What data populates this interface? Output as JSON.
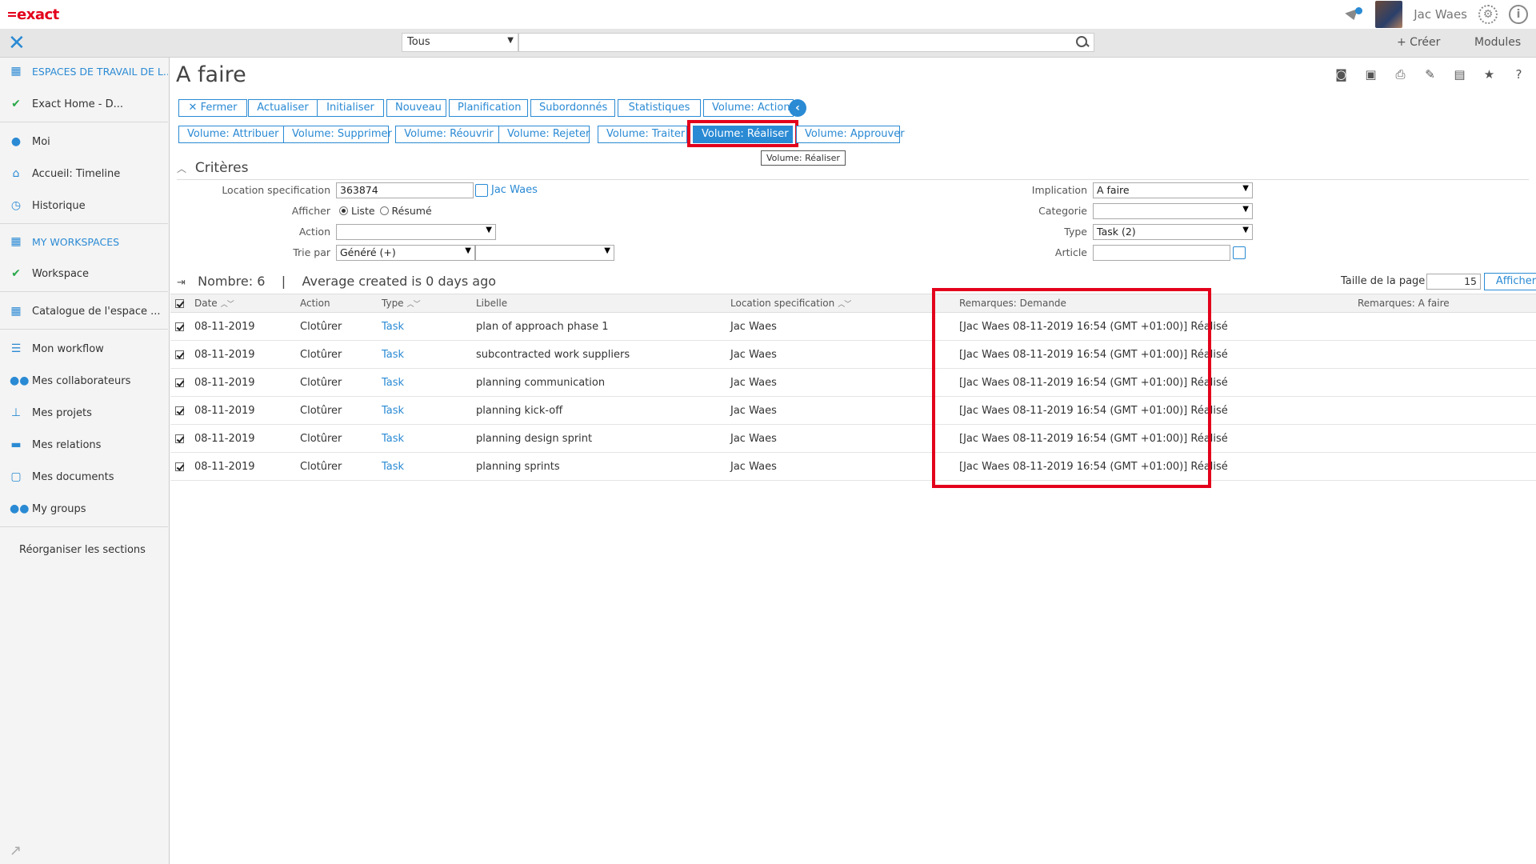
{
  "header": {
    "logo": "exact",
    "user_name": "Jac Waes",
    "info_glyph": "i"
  },
  "navbar": {
    "scope_value": "Tous",
    "search_value": "",
    "create_label": "+ Créer",
    "modules_label": "Modules"
  },
  "sidebar": {
    "items": [
      {
        "label": "ESPACES DE TRAVAIL DE L...",
        "icon": "workspace-icon"
      },
      {
        "label": "Exact Home - D...",
        "icon": "check-icon"
      },
      {
        "label": "Moi",
        "icon": "person-icon"
      },
      {
        "label": "Accueil: Timeline",
        "icon": "home-icon"
      },
      {
        "label": "Historique",
        "icon": "history-icon"
      },
      {
        "label": "MY WORKSPACES",
        "icon": "workspace-icon"
      },
      {
        "label": "Workspace",
        "icon": "check-icon"
      },
      {
        "label": "Catalogue de l'espace ...",
        "icon": "grid-icon"
      },
      {
        "label": "Mon workflow",
        "icon": "list-icon"
      },
      {
        "label": "Mes collaborateurs",
        "icon": "people-icon"
      },
      {
        "label": "Mes projets",
        "icon": "hierarchy-icon"
      },
      {
        "label": "Mes relations",
        "icon": "briefcase-icon"
      },
      {
        "label": "Mes documents",
        "icon": "folder-icon"
      },
      {
        "label": "My groups",
        "icon": "group-icon"
      },
      {
        "label": "Réorganiser les sections",
        "icon": ""
      }
    ]
  },
  "page": {
    "title": "A faire",
    "buttons_row1": [
      "Fermer",
      "Actualiser",
      "Initialiser",
      "Nouveau",
      "Planification",
      "Subordonnés",
      "Statistiques",
      "Volume: Actions"
    ],
    "buttons_row2": [
      "Volume: Attribuer",
      "Volume: Supprimer",
      "Volume: Réouvrir",
      "Volume: Rejeter",
      "Volume: Traiter",
      "Volume: Réaliser",
      "Volume: Approuver"
    ],
    "tooltip": "Volume: Réaliser"
  },
  "criteria": {
    "heading": "Critères",
    "location_label": "Location specification",
    "location_value": "363874",
    "location_link": "Jac Waes",
    "show_label": "Afficher",
    "show_options": [
      "Liste",
      "Résumé"
    ],
    "action_label": "Action",
    "action_value": "",
    "sort_label": "Trie par",
    "sort_value": "Généré (+)",
    "sort_value2": "",
    "implication_label": "Implication",
    "implication_value": "A faire",
    "category_label": "Categorie",
    "category_value": "",
    "type_label": "Type",
    "type_value": "Task (2)",
    "article_label": "Article",
    "article_value": ""
  },
  "summary": {
    "count": "Nombre: 6",
    "separator": "|",
    "average": "Average created is 0 days ago",
    "page_size_label": "Taille de la page",
    "page_size_value": "15",
    "show_button": "Afficher"
  },
  "table": {
    "headers": {
      "date": "Date",
      "action": "Action",
      "type": "Type",
      "libelle": "Libelle",
      "location": "Location specification",
      "remarks_request": "Remarques: Demande",
      "remarks_todo": "Remarques: A faire"
    },
    "rows": [
      {
        "date": "08-11-2019",
        "action": "Clotûrer",
        "type": "Task",
        "libelle": "plan of approach phase 1",
        "location": "Jac Waes",
        "remarks_request": "[Jac Waes 08-11-2019 16:54 (GMT +01:00)] Réalisé",
        "remarks_todo": ""
      },
      {
        "date": "08-11-2019",
        "action": "Clotûrer",
        "type": "Task",
        "libelle": "subcontracted work suppliers",
        "location": "Jac Waes",
        "remarks_request": "[Jac Waes 08-11-2019 16:54 (GMT +01:00)] Réalisé",
        "remarks_todo": ""
      },
      {
        "date": "08-11-2019",
        "action": "Clotûrer",
        "type": "Task",
        "libelle": "planning communication",
        "location": "Jac Waes",
        "remarks_request": "[Jac Waes 08-11-2019 16:54 (GMT +01:00)] Réalisé",
        "remarks_todo": ""
      },
      {
        "date": "08-11-2019",
        "action": "Clotûrer",
        "type": "Task",
        "libelle": "planning kick-off",
        "location": "Jac Waes",
        "remarks_request": "[Jac Waes 08-11-2019 16:54 (GMT +01:00)] Réalisé",
        "remarks_todo": ""
      },
      {
        "date": "08-11-2019",
        "action": "Clotûrer",
        "type": "Task",
        "libelle": "planning design sprint",
        "location": "Jac Waes",
        "remarks_request": "[Jac Waes 08-11-2019 16:54 (GMT +01:00)] Réalisé",
        "remarks_todo": ""
      },
      {
        "date": "08-11-2019",
        "action": "Clotûrer",
        "type": "Task",
        "libelle": "planning sprints",
        "location": "Jac Waes",
        "remarks_request": "[Jac Waes 08-11-2019 16:54 (GMT +01:00)] Réalisé",
        "remarks_todo": ""
      }
    ]
  },
  "colors": {
    "accent": "#2a8ad4",
    "brand": "#e3001b",
    "highlight": "#e3001b"
  }
}
